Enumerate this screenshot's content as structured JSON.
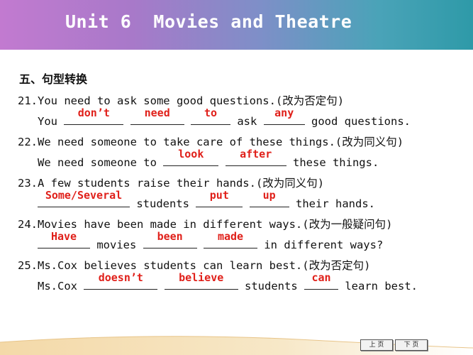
{
  "header": {
    "title": "Unit 6  Movies and Theatre"
  },
  "section_title": "五、句型转换",
  "q21": {
    "prompt": "21.You need to ask some good questions.(改为否定句)",
    "lead": "You ",
    "a1": "don’t",
    "a2": "need",
    "a3": "to",
    "mid": " ask ",
    "a4": "any",
    "tail": " good questions."
  },
  "q22": {
    "prompt": "22.We need someone to take care of these things.(改为同义句)",
    "lead": "We need someone to ",
    "a1": "look",
    "a2": "after",
    "tail": " these things."
  },
  "q23": {
    "prompt": "23.A few students raise their hands.(改为同义句)",
    "a1": "Some/Several",
    "mid": " students ",
    "a2": "put",
    "a3": "up",
    "tail": " their hands."
  },
  "q24": {
    "prompt": "24.Movies have been made in different ways.(改为一般疑问句)",
    "a1": "Have",
    "mid": " movies ",
    "a2": "been",
    "a3": "made",
    "tail": " in different ways?"
  },
  "q25": {
    "prompt": "25.Ms.Cox believes students can learn best.(改为否定句)",
    "lead": "Ms.Cox ",
    "a1": "doesn’t",
    "a2": "believe",
    "mid": " students ",
    "a3": "can",
    "tail": " learn best."
  },
  "nav": {
    "prev": "上 页",
    "next": "下 页"
  },
  "colors": {
    "answer": "#e0201a",
    "header_start": "#c27ad0",
    "header_end": "#2e9aa8"
  }
}
